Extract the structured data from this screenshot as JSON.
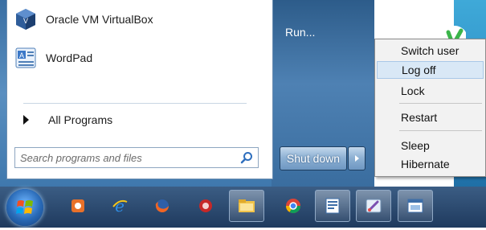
{
  "start_menu": {
    "pinned_items": [
      {
        "label": "Oracle VM VirtualBox",
        "icon": "virtualbox-icon"
      },
      {
        "label": "WordPad",
        "icon": "wordpad-icon"
      }
    ],
    "all_programs_label": "All Programs",
    "search": {
      "placeholder": "Search programs and files",
      "icon": "search-icon"
    },
    "right_pane": {
      "run_label": "Run..."
    },
    "shutdown": {
      "label": "Shut down"
    }
  },
  "power_submenu": {
    "items": [
      {
        "label": "Switch user",
        "highlighted": false
      },
      {
        "label": "Log off",
        "highlighted": true
      },
      {
        "label": "Lock",
        "highlighted": false
      },
      {
        "label": "Restart",
        "highlighted": false
      },
      {
        "label": "Sleep",
        "highlighted": false
      },
      {
        "label": "Hibernate",
        "highlighted": false
      }
    ]
  },
  "taskbar": {
    "start_button": "windows-start-orb",
    "apps": [
      {
        "icon": "media-player-icon"
      },
      {
        "icon": "internet-explorer-icon"
      },
      {
        "icon": "firefox-icon"
      },
      {
        "icon": "app-red-icon"
      },
      {
        "icon": "file-explorer-icon",
        "active": true
      },
      {
        "icon": "chrome-icon"
      },
      {
        "icon": "document-app-icon",
        "active": true
      },
      {
        "icon": "paint-icon",
        "active": true
      },
      {
        "icon": "window-app-icon",
        "active": true
      }
    ]
  },
  "colors": {
    "menu_blue": "#3f78ad",
    "highlight": "#d9e8f6",
    "taskbar": "#1f3a5e"
  }
}
